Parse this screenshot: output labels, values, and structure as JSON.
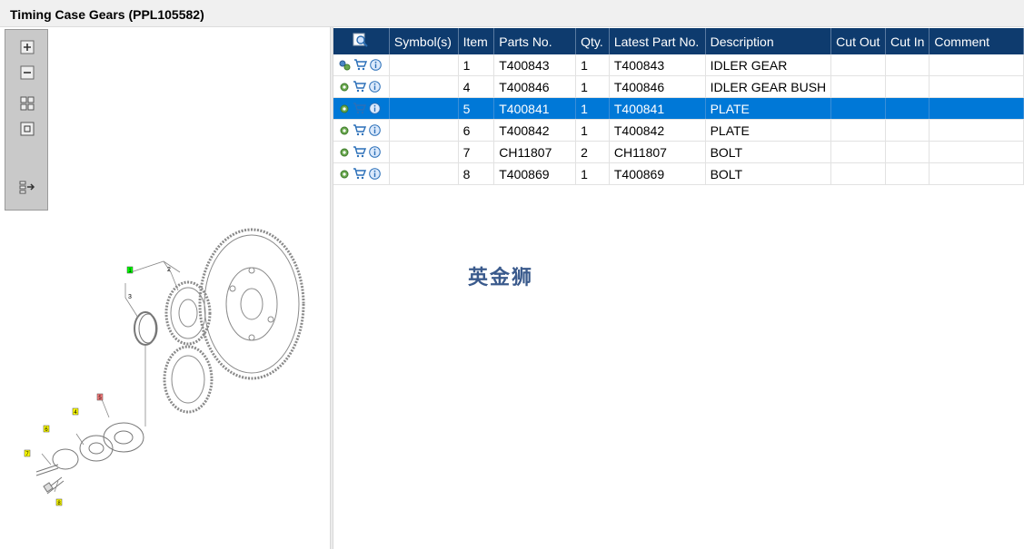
{
  "window": {
    "title": "Timing Case Gears (PPL105582)"
  },
  "toolbar": {
    "buttons": [
      {
        "icon": "zoom-in-icon"
      },
      {
        "icon": "zoom-out-icon"
      },
      {
        "icon": "fit-all-icon"
      },
      {
        "icon": "fit-window-icon"
      },
      {
        "icon": "export-icon"
      }
    ]
  },
  "drawing": {
    "callouts": [
      "1",
      "2",
      "3",
      "4",
      "5",
      "6",
      "7",
      "8"
    ]
  },
  "table": {
    "columns": [
      "Symbol(s)",
      "Item",
      "Parts No.",
      "Qty.",
      "Latest Part No.",
      "Description",
      "Cut Out",
      "Cut In",
      "Comment"
    ],
    "rows": [
      {
        "item": "1",
        "part_no": "T400843",
        "qty": "1",
        "latest": "T400843",
        "description": "IDLER GEAR",
        "selected": false
      },
      {
        "item": "4",
        "part_no": "T400846",
        "qty": "1",
        "latest": "T400846",
        "description": "IDLER GEAR BUSH",
        "selected": false
      },
      {
        "item": "5",
        "part_no": "T400841",
        "qty": "1",
        "latest": "T400841",
        "description": "PLATE",
        "selected": true
      },
      {
        "item": "6",
        "part_no": "T400842",
        "qty": "1",
        "latest": "T400842",
        "description": "PLATE",
        "selected": false
      },
      {
        "item": "7",
        "part_no": "CH11807",
        "qty": "2",
        "latest": "CH11807",
        "description": "BOLT",
        "selected": false
      },
      {
        "item": "8",
        "part_no": "T400869",
        "qty": "1",
        "latest": "T400869",
        "description": "BOLT",
        "selected": false
      }
    ]
  },
  "watermark": {
    "text": "英金狮"
  },
  "colors": {
    "header": "#0e3b6e",
    "selection": "#0078d7",
    "callout_yellow": "#ffff00",
    "callout_green": "#00ff00",
    "callout_red": "#ff7f7f"
  }
}
